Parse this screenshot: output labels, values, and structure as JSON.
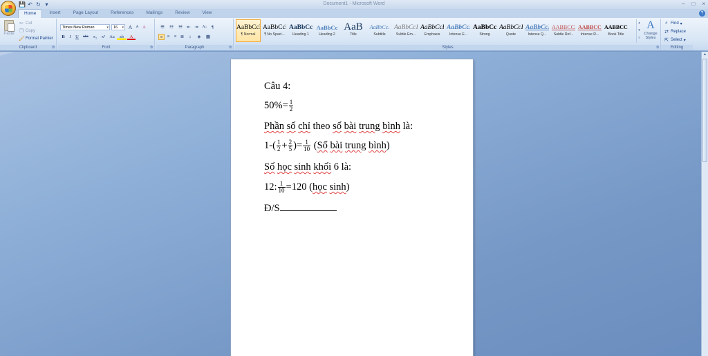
{
  "window": {
    "title": "Document1 - Microsoft Word",
    "minimize": "–",
    "maximize": "□",
    "close": "×"
  },
  "qat": {
    "save": "💾",
    "undo": "↶",
    "redo": "↻",
    "more": "▾"
  },
  "tabs": [
    "Home",
    "Insert",
    "Page Layout",
    "References",
    "Mailings",
    "Review",
    "View"
  ],
  "help": "?",
  "ribbon": {
    "clipboard": {
      "label": "Clipboard",
      "paste": "Paste",
      "cut": "Cut",
      "copy": "Copy",
      "format_painter": "Format Painter"
    },
    "font": {
      "label": "Font",
      "font_name": "Times New Roman",
      "font_size": "16",
      "grow": "A",
      "shrink": "A",
      "clear": "A",
      "bold": "B",
      "italic": "I",
      "underline": "U",
      "strike": "abe",
      "subscript": "x₂",
      "superscript": "x²",
      "change_case": "Aa",
      "highlight": "ab",
      "font_color": "A"
    },
    "paragraph": {
      "label": "Paragraph",
      "sort": "A↓",
      "pilcrow": "¶"
    },
    "styles": {
      "label": "Styles",
      "items": [
        {
          "sample": "AaBbCcI",
          "name": "¶ Normal"
        },
        {
          "sample": "AaBbCcI",
          "name": "¶ No Spaci..."
        },
        {
          "sample": "AaBbCc",
          "name": "Heading 1"
        },
        {
          "sample": "AaBbCc",
          "name": "Heading 2"
        },
        {
          "sample": "AaB",
          "name": "Title"
        },
        {
          "sample": "AaBbCc.",
          "name": "Subtitle"
        },
        {
          "sample": "AaBbCcI",
          "name": "Subtle Em..."
        },
        {
          "sample": "AaBbCcI",
          "name": "Emphasis"
        },
        {
          "sample": "AaBbCcI",
          "name": "Intense E..."
        },
        {
          "sample": "AaBbCcI",
          "name": "Strong"
        },
        {
          "sample": "AaBbCcI",
          "name": "Quote"
        },
        {
          "sample": "AaBbCcI",
          "name": "Intense Q..."
        },
        {
          "sample": "AABBCCI",
          "name": "Subtle Ref..."
        },
        {
          "sample": "AABBCCI",
          "name": "Intense R..."
        },
        {
          "sample": "AABBCCI",
          "name": "Book Title"
        }
      ],
      "change_styles": "Change Styles"
    },
    "editing": {
      "label": "Editing",
      "find": "Find",
      "replace": "Replace",
      "select": "Select"
    }
  },
  "document": {
    "line1": "Câu 4:",
    "line2_prefix": "50%=",
    "frac_half_num": "1",
    "frac_half_den": "2",
    "line3_w1": "Phần",
    "line3_w2": "số",
    "line3_w3": "chỉ",
    "line3_rest": "theo",
    "line3_w4": "số",
    "line3_w5": "bài",
    "line3_w6": "trung",
    "line3_w7": "bình",
    "line3_end": "là:",
    "line4_prefix": "1-(",
    "f1_num": "1",
    "f1_den": "2",
    "plus": "+",
    "f2_num": "2",
    "f2_den": "5",
    "line4_close": ")=",
    "f3_num": "1",
    "f3_den": "10",
    "line4_note_open": "(",
    "line4_note_w1": "Số",
    "line4_note_w2": "bài",
    "line4_note_w3": "trung",
    "line4_note_w4": "bình",
    "line4_note_close": ")",
    "line5_w1": "Số",
    "line5_w2": "học",
    "line5_w3": "sinh",
    "line5_w4": "khối",
    "line5_end": "6 là:",
    "line6_prefix": "12:",
    "f4_num": "1",
    "f4_den": "10",
    "line6_mid": "=120",
    "line6_note_open": "(",
    "line6_note_w1": "học",
    "line6_note_w2": "sinh",
    "line6_note_close": ")",
    "line7": "Đ/S"
  }
}
